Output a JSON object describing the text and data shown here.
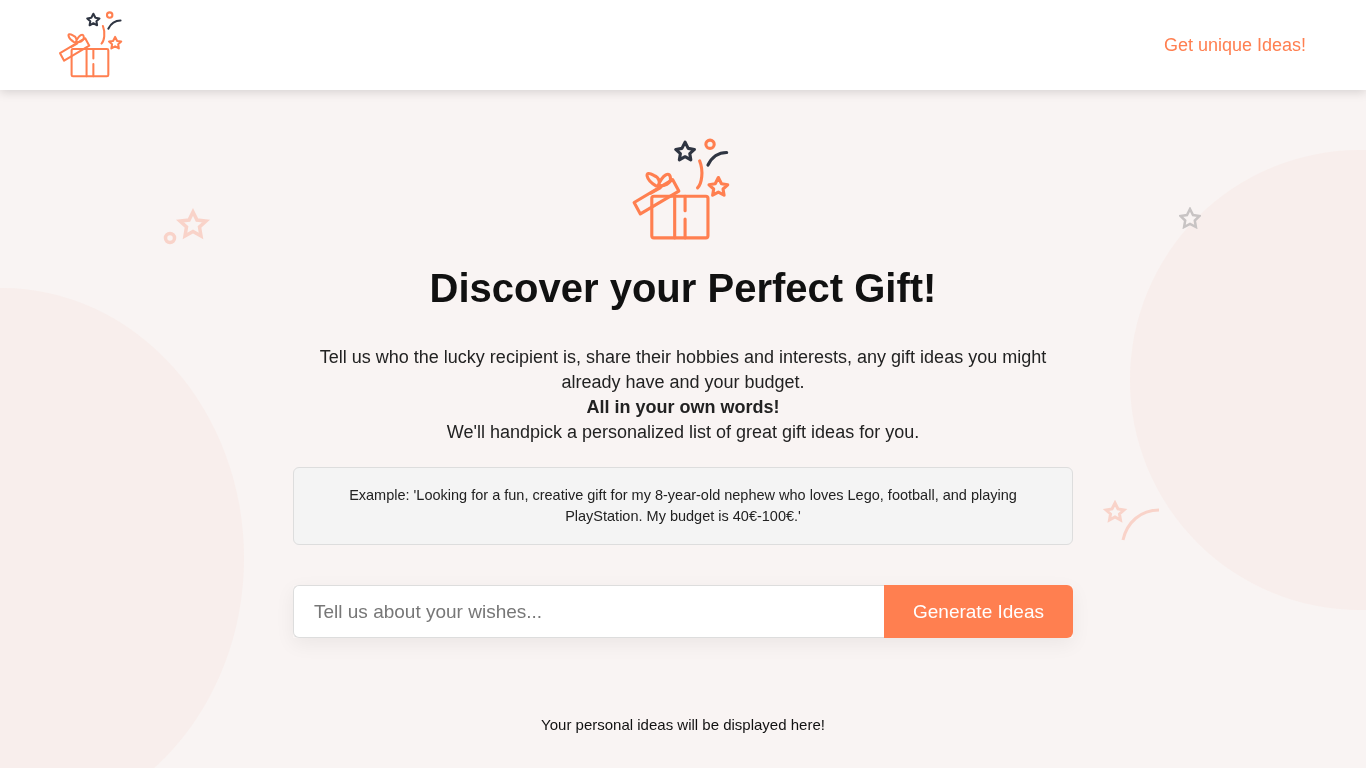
{
  "header": {
    "link": "Get unique Ideas!"
  },
  "hero": {
    "title": "Discover your Perfect Gift!",
    "intro": "Tell us who the lucky recipient is, share their hobbies and interests, any gift ideas you might already have and your budget.\n**All in your own words!**\nWe'll handpick a personalized list of great gift ideas for you.",
    "example": "Example: 'Looking for a fun, creative gift for my 8-year-old nephew who loves Lego, football, and playing PlayStation. My budget is 40€-100€.'"
  },
  "form": {
    "placeholder": "Tell us about your wishes...",
    "button": "Generate Ideas"
  },
  "results": {
    "message": "Your personal ideas will be displayed here!"
  }
}
